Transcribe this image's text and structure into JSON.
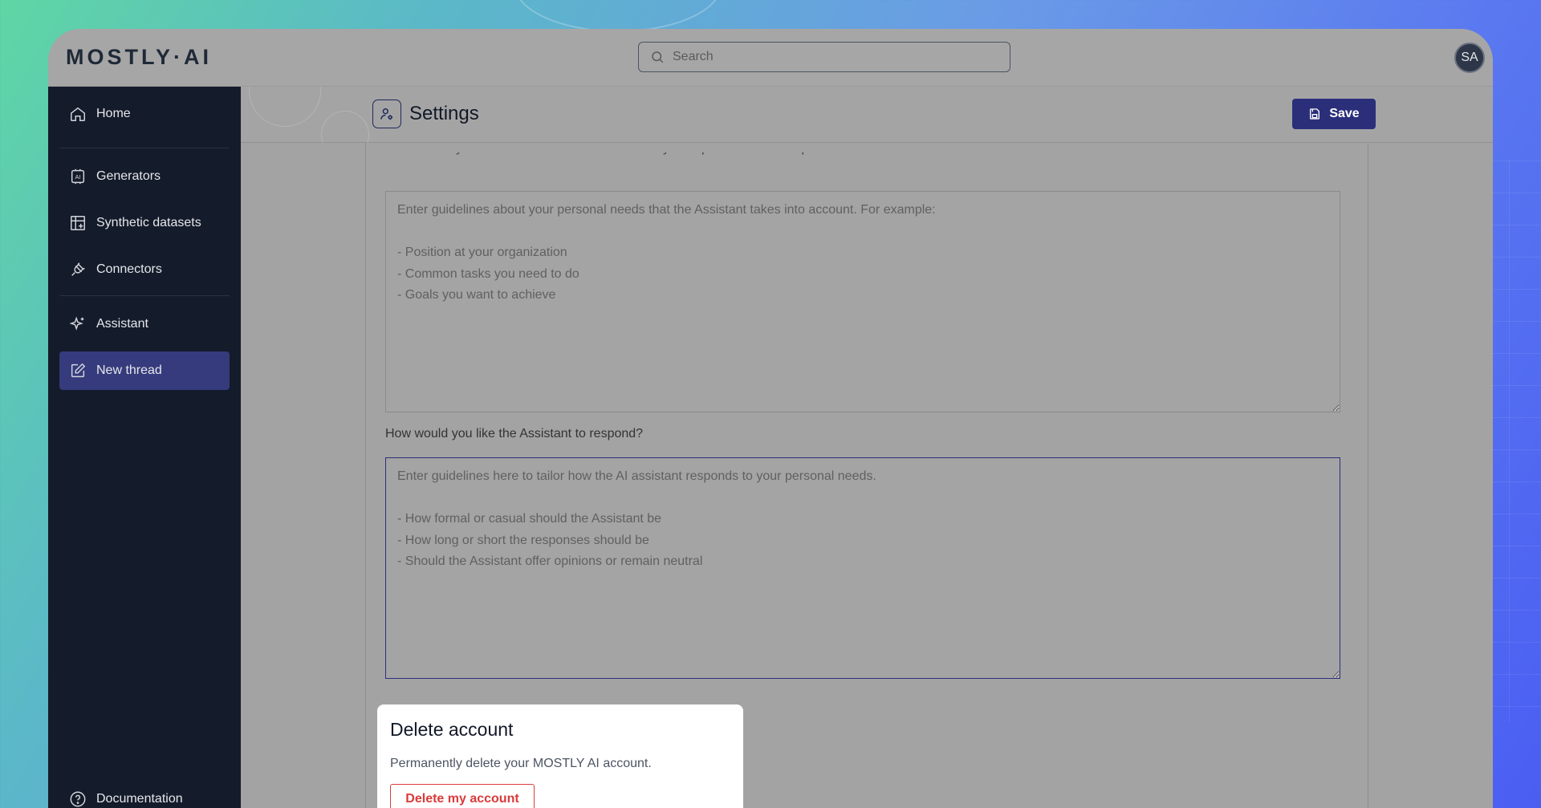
{
  "app": {
    "logo": "MOSTLY·AI"
  },
  "search": {
    "placeholder": "Search"
  },
  "user": {
    "initials": "SA"
  },
  "sidebar": {
    "items": [
      {
        "label": "Home",
        "icon": "home-icon"
      },
      {
        "label": "Generators",
        "icon": "ai-chip-icon"
      },
      {
        "label": "Synthetic datasets",
        "icon": "table-plus-icon"
      },
      {
        "label": "Connectors",
        "icon": "plug-icon"
      },
      {
        "label": "Assistant",
        "icon": "sparkle-icon"
      },
      {
        "label": "New thread",
        "icon": "edit-icon",
        "active": true
      }
    ],
    "footer": {
      "label": "Documentation",
      "icon": "help-circle-icon"
    }
  },
  "page": {
    "title": "Settings",
    "save_label": "Save"
  },
  "assistant_settings": {
    "about_you_label": "What would you like the Assistant to know about you to provide better responses?",
    "about_you_placeholder": "Enter guidelines about your personal needs that the Assistant takes into account. For example:\n\n- Position at your organization\n- Common tasks you need to do\n- Goals you want to achieve",
    "respond_label": "How would you like the Assistant to respond?",
    "respond_placeholder": "Enter guidelines here to tailor how the AI assistant responds to your personal needs.\n\n- How formal or casual should the Assistant be\n- How long or short the responses should be\n- Should the Assistant offer opinions or remain neutral"
  },
  "delete_account": {
    "title": "Delete account",
    "description": "Permanently delete your MOSTLY AI account.",
    "button_label": "Delete my account"
  },
  "colors": {
    "sidebar_bg": "#141b2a",
    "accent": "#2b2f7a",
    "danger": "#dc3c3c"
  }
}
